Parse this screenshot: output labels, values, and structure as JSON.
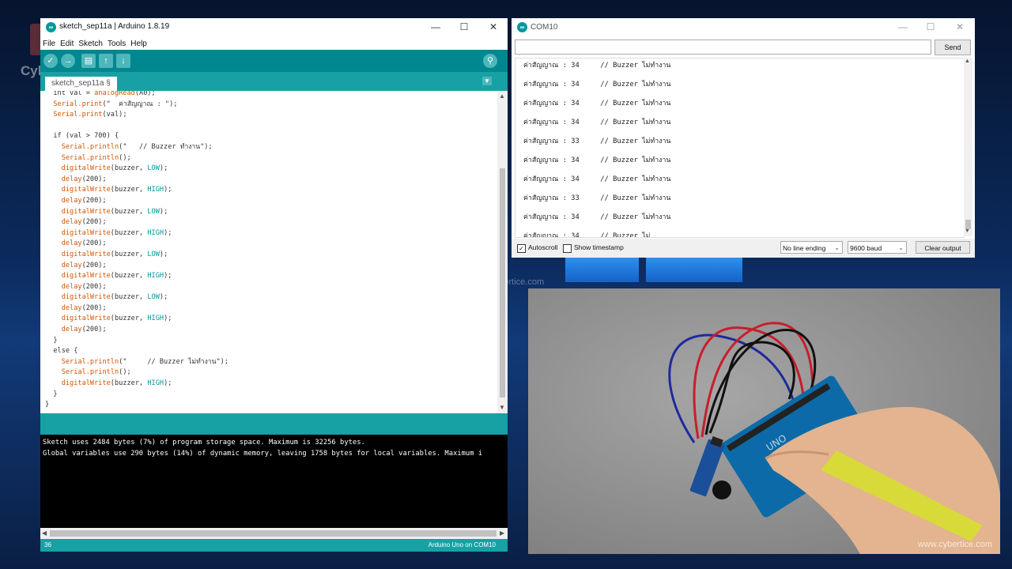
{
  "brand": {
    "logo_text": "Cybertice",
    "center_watermark": "www.cybertice.com",
    "photo_watermark": "www.cybertice.com"
  },
  "ide": {
    "title": "sketch_sep11a | Arduino 1.8.19",
    "menu": [
      "File",
      "Edit",
      "Sketch",
      "Tools",
      "Help"
    ],
    "toolbar": {
      "verify": "✓",
      "upload": "→",
      "new": "▤",
      "open": "↑",
      "save": "↓",
      "serial_monitor": "⚲"
    },
    "tab_name": "sketch_sep11a §",
    "code_lines": [
      "  int val = analogRead(A0);",
      "  Serial.print(\"  ค่าสัญญาณ : \");",
      "  Serial.print(val);",
      "",
      "  if (val > 700) {",
      "    Serial.println(\"   // Buzzer ทำงาน\");",
      "    Serial.println();",
      "    digitalWrite(buzzer, LOW);",
      "    delay(200);",
      "    digitalWrite(buzzer, HIGH);",
      "    delay(200);",
      "    digitalWrite(buzzer, LOW);",
      "    delay(200);",
      "    digitalWrite(buzzer, HIGH);",
      "    delay(200);",
      "    digitalWrite(buzzer, LOW);",
      "    delay(200);",
      "    digitalWrite(buzzer, HIGH);",
      "    delay(200);",
      "    digitalWrite(buzzer, LOW);",
      "    delay(200);",
      "    digitalWrite(buzzer, HIGH);",
      "    delay(200);",
      "  }",
      "  else {",
      "    Serial.println(\"     // Buzzer ไม่ทำงาน\");",
      "    Serial.println();",
      "    digitalWrite(buzzer, HIGH);",
      "  }",
      "}"
    ],
    "console": [
      "Sketch uses 2484 bytes (7%) of program storage space. Maximum is 32256 bytes.",
      "Global variables use 290 bytes (14%) of dynamic memory, leaving 1758 bytes for local variables. Maximum i"
    ],
    "status_line": "36",
    "status_board": "Arduino Uno on COM10"
  },
  "serial": {
    "title": "COM10",
    "input_value": "",
    "send_label": "Send",
    "rows": [
      "ค่าสัญญาณ : 34     // Buzzer ไม่ทำงาน",
      "ค่าสัญญาณ : 34     // Buzzer ไม่ทำงาน",
      "ค่าสัญญาณ : 34     // Buzzer ไม่ทำงาน",
      "ค่าสัญญาณ : 34     // Buzzer ไม่ทำงาน",
      "ค่าสัญญาณ : 33     // Buzzer ไม่ทำงาน",
      "ค่าสัญญาณ : 34     // Buzzer ไม่ทำงาน",
      "ค่าสัญญาณ : 34     // Buzzer ไม่ทำงาน",
      "ค่าสัญญาณ : 33     // Buzzer ไม่ทำงาน",
      "ค่าสัญญาณ : 34     // Buzzer ไม่ทำงาน",
      "ค่าสัญญาณ : 34     // Buzzer ไม่"
    ],
    "autoscroll_label": "Autoscroll",
    "autoscroll_checked": true,
    "timestamp_label": "Show timestamp",
    "timestamp_checked": false,
    "line_ending": "No line ending",
    "baud": "9600 baud",
    "clear_label": "Clear output"
  },
  "colors": {
    "teal_dark": "#00878f",
    "teal": "#17a1a5",
    "keyword": "#d35400",
    "function": "#00979c"
  }
}
